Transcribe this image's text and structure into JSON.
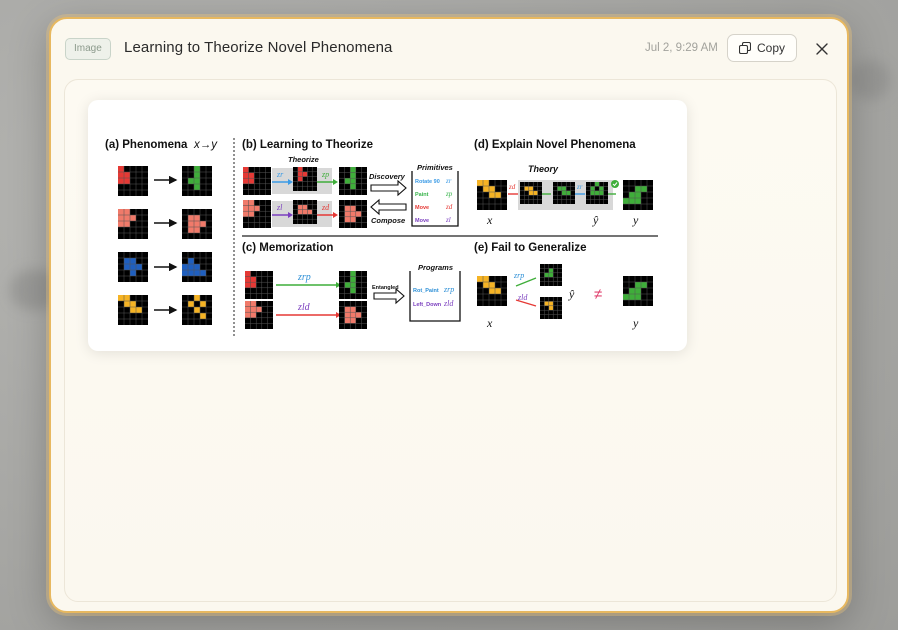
{
  "modal": {
    "badge": "Image",
    "title": "Learning to Theorize Novel Phenomena",
    "timestamp": "Jul 2, 9:29 AM",
    "copy_label": "Copy",
    "icons": {
      "copy": "copy-icon",
      "close": "close-icon"
    }
  },
  "figure": {
    "panel_a_title": "(a) Phenomena",
    "panel_a_math": "x→y",
    "panel_b_title": "(b) Learning to Theorize",
    "theorize_label": "Theorize",
    "discovery_label": "Discovery",
    "compose_label": "Compose",
    "primitives_title": "Primitives",
    "primitives": [
      {
        "label": "Rotate 90",
        "symbol": "zr",
        "color": "#3b9be6"
      },
      {
        "label": "Paint",
        "symbol": "zp",
        "color": "#37b34a"
      },
      {
        "label": "Move",
        "symbol": "zd",
        "color": "#e53935"
      },
      {
        "label": "Move",
        "symbol": "zl",
        "color": "#7b3fbf"
      }
    ],
    "panel_c_title": "(c) Memorization",
    "entangled_label": "Entangled",
    "programs_title": "Programs",
    "programs": [
      {
        "label": "Rot_Paint",
        "symbol": "zrp",
        "color": "#2c8fd6"
      },
      {
        "label": "Left_Down",
        "symbol": "zld",
        "color": "#7b3fbf"
      }
    ],
    "panel_d_title": "(d) Explain Novel Phenomena",
    "theory_label": "Theory",
    "panel_e_title": "(e) Fail to Generalize",
    "sym_x": "x",
    "sym_y": "y",
    "sym_yhat": "ŷ",
    "sym_neq": "≠",
    "sym_zr": "zr",
    "sym_zp": "zp",
    "sym_zd": "zd",
    "sym_zl": "zl",
    "sym_zrp": "zrp",
    "sym_zld": "zld",
    "colors": {
      "red": "#e53935",
      "salmon": "#f07a6a",
      "green": "#3fae3a",
      "blue": "#1f5fbf",
      "yellow": "#f5b324",
      "purple": "#7b3fbf",
      "cyan": "#3b9be6"
    }
  }
}
